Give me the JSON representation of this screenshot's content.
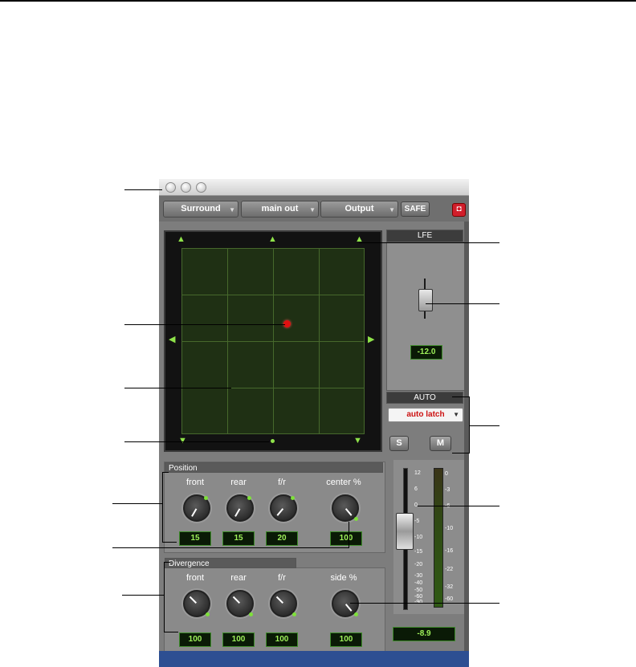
{
  "toolbar": {
    "surround_label": "Surround",
    "main_out_label": "main out",
    "output_label": "Output",
    "safe_label": "SAFE",
    "close_glyph": "◘"
  },
  "lfe": {
    "title": "LFE",
    "value": "-12.0"
  },
  "auto": {
    "title": "AUTO",
    "mode": "auto latch",
    "solo_label": "S",
    "mute_label": "M"
  },
  "position": {
    "title": "Position",
    "knobs": [
      {
        "label": "front",
        "value": "15"
      },
      {
        "label": "rear",
        "value": "15"
      },
      {
        "label": "f/r",
        "value": "20"
      },
      {
        "label": "center %",
        "value": "100"
      }
    ]
  },
  "divergence": {
    "title": "Divergence",
    "knobs": [
      {
        "label": "front",
        "value": "100"
      },
      {
        "label": "rear",
        "value": "100"
      },
      {
        "label": "f/r",
        "value": "100"
      },
      {
        "label": "side %",
        "value": "100"
      }
    ]
  },
  "fader": {
    "scale": [
      "12",
      "6",
      "0",
      "-5",
      "-10",
      "-15",
      "-20",
      "-30",
      "-40",
      "-50",
      "-60",
      "-90"
    ],
    "meter_scale": [
      "0",
      "-3",
      "-6",
      "-10",
      "-16",
      "-22",
      "-32",
      "-60"
    ],
    "value": "-8.9"
  },
  "colors": {
    "accent_green": "#8fe34a",
    "panner_dot": "#e01010",
    "mode_text": "#cc1111"
  }
}
